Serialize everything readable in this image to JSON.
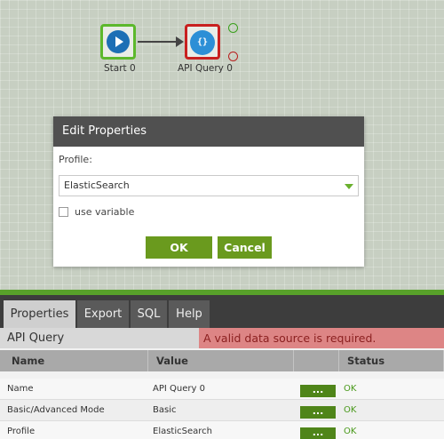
{
  "flow": {
    "start_node": {
      "label": "Start 0",
      "icon": "play-icon"
    },
    "api_node": {
      "label": "API Query 0",
      "icon": "cloud-api-icon",
      "glyph": "{}"
    }
  },
  "dialog": {
    "title": "Edit Properties",
    "profile_label": "Profile:",
    "profile_value": "ElasticSearch",
    "use_variable_label": "use variable",
    "use_variable_checked": false,
    "ok_label": "OK",
    "cancel_label": "Cancel"
  },
  "panel": {
    "tabs": [
      {
        "label": "Properties",
        "active": true
      },
      {
        "label": "Export",
        "active": false
      },
      {
        "label": "SQL",
        "active": false
      },
      {
        "label": "Help",
        "active": false
      }
    ],
    "title": "API Query",
    "error_message": "A valid data source is required.",
    "columns": [
      "Name",
      "Value",
      "",
      "Status"
    ],
    "rows": [
      {
        "name": "Name",
        "value": "API Query 0",
        "button": "...",
        "status": "OK"
      },
      {
        "name": "Basic/Advanced Mode",
        "value": "Basic",
        "button": "...",
        "status": "OK"
      },
      {
        "name": "Profile",
        "value": "ElasticSearch",
        "button": "...",
        "status": "OK"
      }
    ]
  },
  "colors": {
    "accent_green": "#58a12a",
    "button_green": "#6a9a1e",
    "error_red": "#c8201f",
    "error_banner": "#dd8585",
    "start_border": "#5cb82c",
    "header_dark": "#505050"
  }
}
